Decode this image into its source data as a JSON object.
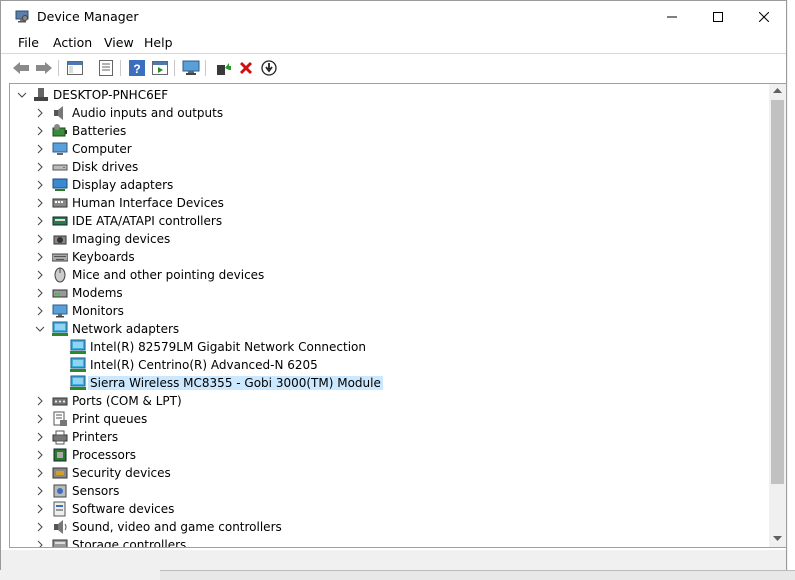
{
  "window": {
    "title": "Device Manager",
    "app_icon": "device-manager-icon"
  },
  "window_controls": {
    "minimize": "minimize-icon",
    "maximize": "maximize-icon",
    "close": "close-icon"
  },
  "menu": {
    "file": "File",
    "action": "Action",
    "view": "View",
    "help": "Help"
  },
  "toolbar": {
    "buttons": [
      "back-arrow-icon",
      "forward-arrow-icon",
      "console-tree-icon",
      "properties-icon",
      "help-icon",
      "show-hide-icon",
      "scan-hardware-icon",
      "update-driver-icon",
      "uninstall-icon",
      "disable-icon"
    ]
  },
  "tree": {
    "root": "DESKTOP-PNHC6EF",
    "items": [
      {
        "label": "Audio inputs and outputs",
        "icon": "speaker-icon"
      },
      {
        "label": "Batteries",
        "icon": "battery-icon"
      },
      {
        "label": "Computer",
        "icon": "computer-icon"
      },
      {
        "label": "Disk drives",
        "icon": "disk-drive-icon"
      },
      {
        "label": "Display adapters",
        "icon": "display-adapter-icon"
      },
      {
        "label": "Human Interface Devices",
        "icon": "hid-icon"
      },
      {
        "label": "IDE ATA/ATAPI controllers",
        "icon": "ide-controller-icon"
      },
      {
        "label": "Imaging devices",
        "icon": "camera-icon"
      },
      {
        "label": "Keyboards",
        "icon": "keyboard-icon"
      },
      {
        "label": "Mice and other pointing devices",
        "icon": "mouse-icon"
      },
      {
        "label": "Modems",
        "icon": "modem-icon"
      },
      {
        "label": "Monitors",
        "icon": "monitor-icon"
      },
      {
        "label": "Network adapters",
        "icon": "network-adapter-icon",
        "expanded": true
      },
      {
        "label": "Ports (COM & LPT)",
        "icon": "port-icon"
      },
      {
        "label": "Print queues",
        "icon": "print-queue-icon"
      },
      {
        "label": "Printers",
        "icon": "printer-icon"
      },
      {
        "label": "Processors",
        "icon": "processor-icon"
      },
      {
        "label": "Security devices",
        "icon": "security-device-icon"
      },
      {
        "label": "Sensors",
        "icon": "sensor-icon"
      },
      {
        "label": "Software devices",
        "icon": "software-device-icon"
      },
      {
        "label": "Sound, video and game controllers",
        "icon": "sound-icon"
      },
      {
        "label": "Storage controllers",
        "icon": "storage-controller-icon"
      }
    ],
    "network_children": [
      {
        "label": "Intel(R) 82579LM Gigabit Network Connection",
        "icon": "network-adapter-icon"
      },
      {
        "label": "Intel(R) Centrino(R) Advanced-N 6205",
        "icon": "network-adapter-icon"
      },
      {
        "label": "Sierra Wireless MC8355 - Gobi 3000(TM) Module",
        "icon": "network-adapter-icon",
        "selected": true
      }
    ]
  },
  "colors": {
    "selection": "#cce8ff",
    "accent": "#3c82c8"
  }
}
